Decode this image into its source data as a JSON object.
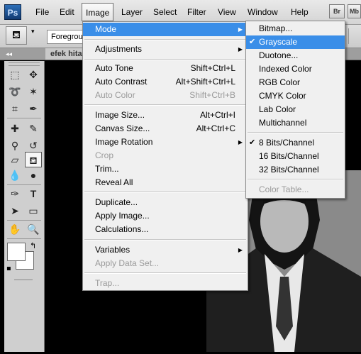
{
  "app": {
    "logo": "Ps"
  },
  "menubar": {
    "items": [
      "File",
      "Edit",
      "Image",
      "Layer",
      "Select",
      "Filter",
      "View",
      "Window",
      "Help"
    ],
    "active": "Image",
    "right_buttons": [
      "Br",
      "Mb"
    ]
  },
  "options_bar": {
    "fill_source": "Foregrou"
  },
  "document": {
    "tab_title": "efek hita"
  },
  "image_menu": {
    "items": [
      {
        "label": "Mode",
        "submenu": true,
        "highlight": true
      },
      {
        "sep": true
      },
      {
        "label": "Adjustments",
        "submenu": true
      },
      {
        "sep": true
      },
      {
        "label": "Auto Tone",
        "shortcut": "Shift+Ctrl+L"
      },
      {
        "label": "Auto Contrast",
        "shortcut": "Alt+Shift+Ctrl+L"
      },
      {
        "label": "Auto Color",
        "shortcut": "Shift+Ctrl+B",
        "disabled": true
      },
      {
        "sep": true
      },
      {
        "label": "Image Size...",
        "shortcut": "Alt+Ctrl+I"
      },
      {
        "label": "Canvas Size...",
        "shortcut": "Alt+Ctrl+C"
      },
      {
        "label": "Image Rotation",
        "submenu": true
      },
      {
        "label": "Crop",
        "disabled": true
      },
      {
        "label": "Trim..."
      },
      {
        "label": "Reveal All"
      },
      {
        "sep": true
      },
      {
        "label": "Duplicate..."
      },
      {
        "label": "Apply Image..."
      },
      {
        "label": "Calculations..."
      },
      {
        "sep": true
      },
      {
        "label": "Variables",
        "submenu": true
      },
      {
        "label": "Apply Data Set...",
        "disabled": true
      },
      {
        "sep": true
      },
      {
        "label": "Trap...",
        "disabled": true
      }
    ]
  },
  "mode_submenu": {
    "items": [
      {
        "label": "Bitmap..."
      },
      {
        "label": "Grayscale",
        "checked": true,
        "highlight": true
      },
      {
        "label": "Duotone..."
      },
      {
        "label": "Indexed Color"
      },
      {
        "label": "RGB Color"
      },
      {
        "label": "CMYK Color"
      },
      {
        "label": "Lab Color"
      },
      {
        "label": "Multichannel"
      },
      {
        "sep": true
      },
      {
        "label": "8 Bits/Channel",
        "checked": true
      },
      {
        "label": "16 Bits/Channel"
      },
      {
        "label": "32 Bits/Channel"
      },
      {
        "sep": true
      },
      {
        "label": "Color Table...",
        "disabled": true
      }
    ]
  },
  "colors": {
    "highlight": "#3a8ee8",
    "menu_bg": "#f0f0f0",
    "disabled_text": "#9a9a9a"
  },
  "check_glyph": "✔",
  "submenu_arrow": "▶",
  "panel_collapse": "◂◂"
}
